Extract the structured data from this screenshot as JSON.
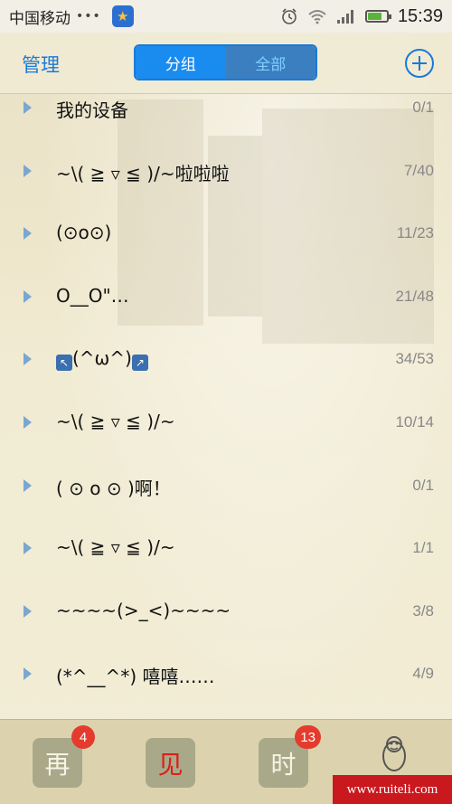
{
  "status_bar": {
    "carrier": "中国移动",
    "signal_dots": "•••",
    "time": "15:39",
    "battery_level": 0.75
  },
  "header": {
    "manage_label": "管理",
    "segments": [
      {
        "label": "分组",
        "selected": true
      },
      {
        "label": "全部",
        "selected": false
      }
    ],
    "add_icon": "plus-circle-icon"
  },
  "groups": [
    {
      "name": "我的设备",
      "count": "0/1"
    },
    {
      "name": "~\\( ≧ ▿ ≦ )/~啦啦啦",
      "count": "7/40"
    },
    {
      "name": "(⊙o⊙)",
      "count": "11/23"
    },
    {
      "name": "O__O\"…",
      "count": "21/48"
    },
    {
      "name": "(^ω^)",
      "count": "34/53"
    },
    {
      "name": "~\\( ≧ ▿ ≦ )/~",
      "count": "10/14"
    },
    {
      "name": "( ⊙ o ⊙ )啊！",
      "count": "0/1"
    },
    {
      "name": "~\\( ≧ ▿ ≦ )/~",
      "count": "1/1"
    },
    {
      "name": "~~~~(>_<)~~~~",
      "count": "3/8"
    },
    {
      "name": "(*^__^*) 嘻嘻……",
      "count": "4/9"
    }
  ],
  "tabbar": {
    "tabs": [
      {
        "label": "再",
        "badge": "4"
      },
      {
        "label": "见",
        "badge": ""
      },
      {
        "label": "时",
        "badge": "13"
      }
    ],
    "penguin_icon": "qq-penguin-icon"
  },
  "watermark": "www.ruiteli.com",
  "colors": {
    "accent": "#1a8cf0",
    "badge": "#e53b2e",
    "watermark_bg": "#c9181e"
  }
}
